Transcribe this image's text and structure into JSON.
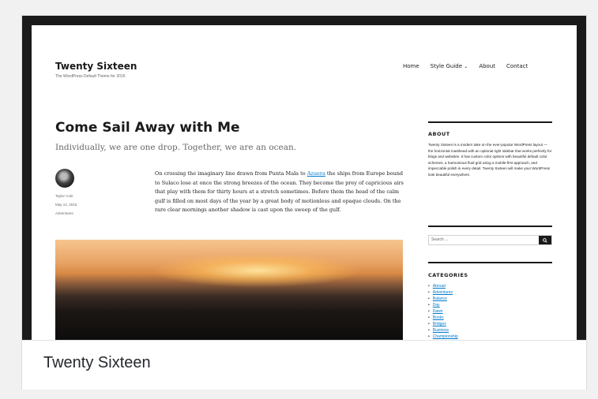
{
  "site": {
    "title": "Twenty Sixteen",
    "description": "The WordPress Default Theme for 2016",
    "nav": [
      "Home",
      "Style Guide",
      "About",
      "Contact"
    ]
  },
  "post": {
    "title": "Come Sail Away with Me",
    "excerpt": "Individually, we are one drop. Together, we are an ocean.",
    "meta": {
      "author": "Taylor Cole",
      "date": "May 14, 2015",
      "category": "Adventures"
    },
    "body_before": "On crossing the imaginary line drawn from Punta Mala to ",
    "body_link": "Azuera",
    "body_after": " the ships from Europe bound to Sulaco lose at once the strong breezes of the ocean. They become the prey of capricious airs that play with them for thirty hours at a stretch sometimes. Before them the head of the calm gulf is filled on most days of the year by a great body of motionless and opaque clouds. On the rare clear mornings another shadow is cast upon the sweep of the gulf."
  },
  "sidebar": {
    "about_title": "ABOUT",
    "about_text": "Twenty Sixteen is a modern take on the ever-popular WordPress layout — the horizontal masthead with an optional right sidebar that works perfectly for blogs and websites. It has custom color options with beautiful default color schemes, a harmonious fluid grid using a mobile-first approach, and impeccable polish in every detail. Twenty Sixteen will make your WordPress look beautiful everywhere.",
    "search_placeholder": "Search ...",
    "categories_title": "CATEGORIES",
    "categories": [
      "Abroad",
      "Adventures",
      "Balance",
      "Day",
      "Dawn",
      "Books",
      "Bridges",
      "Business",
      "Championship"
    ]
  },
  "theme": {
    "name": "Twenty Sixteen"
  }
}
